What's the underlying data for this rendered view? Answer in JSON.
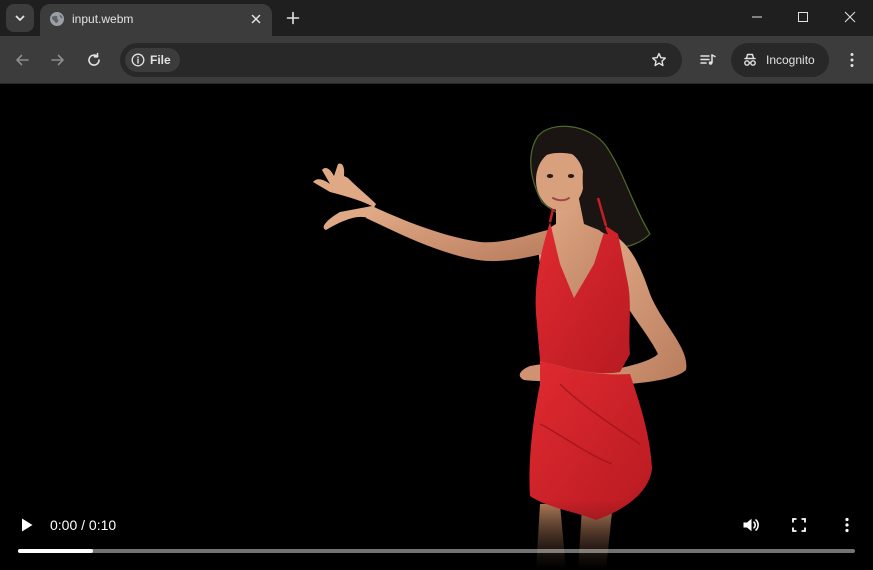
{
  "tab": {
    "title": "input.webm",
    "favicon": "globe-icon",
    "close_icon": "close-icon"
  },
  "window_controls": [
    "minimize-icon",
    "maximize-icon",
    "close-icon"
  ],
  "toolbar": {
    "back_icon": "back-arrow-icon",
    "forward_icon": "forward-arrow-icon",
    "reload_icon": "reload-icon",
    "site_info_label": "File",
    "bookmark_icon": "star-icon",
    "media_icon": "media-controls-icon",
    "profile_label": "Incognito",
    "menu_icon": "kebab-menu-icon"
  },
  "video": {
    "time_display": "0:00 / 0:10",
    "progress_fraction": 0.09,
    "play_icon": "play-icon",
    "volume_icon": "volume-icon",
    "fullscreen_icon": "fullscreen-icon",
    "more_icon": "more-options-icon",
    "subject": "woman in red dress gesturing on black background"
  },
  "colors": {
    "tabstrip_bg": "#1f1f1f",
    "toolbar_bg": "#3c3c3c",
    "omnibox_bg": "#282828",
    "dress_red": "#d4232b",
    "video_bg": "#000000"
  }
}
